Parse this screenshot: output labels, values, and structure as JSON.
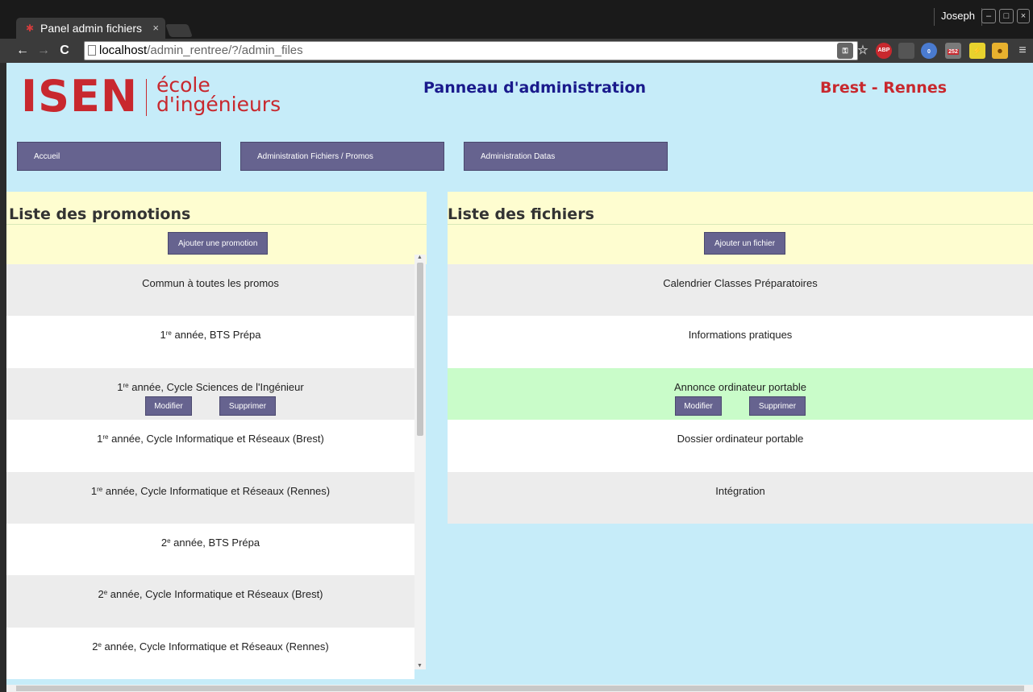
{
  "browser": {
    "tab_title": "Panel admin fichiers",
    "tab_close": "×",
    "user": "Joseph",
    "url_host": "localhost",
    "url_path": "/admin_rentree/?/admin_files",
    "back": "←",
    "forward": "→",
    "reload": "C",
    "ext_abp": "ABP",
    "ext_badge_0": "0",
    "ext_badge_252": "252"
  },
  "header": {
    "logo_main": "ISEN",
    "logo_sub_1": "école",
    "logo_sub_2": "d'ingénieurs",
    "title": "Panneau d'administration",
    "campus": "Brest - Rennes"
  },
  "nav": {
    "items": [
      {
        "label": "Accueil"
      },
      {
        "label": "Administration Fichiers / Promos"
      },
      {
        "label": "Administration Datas"
      }
    ]
  },
  "promotions": {
    "title": "Liste des promotions",
    "add_label": "Ajouter une promotion",
    "items": [
      {
        "prefix": "",
        "sup": "",
        "text": "Commun à toutes les promos"
      },
      {
        "prefix": "1",
        "sup": "re",
        "text": " année, BTS Prépa"
      },
      {
        "prefix": "1",
        "sup": "re",
        "text": " année, Cycle Sciences de l'Ingénieur"
      },
      {
        "prefix": "1",
        "sup": "re",
        "text": " année, Cycle Informatique et Réseaux (Brest)"
      },
      {
        "prefix": "1",
        "sup": "re",
        "text": " année, Cycle Informatique et Réseaux (Rennes)"
      },
      {
        "prefix": "2",
        "sup": "e",
        "text": " année, BTS Prépa"
      },
      {
        "prefix": "2",
        "sup": "e",
        "text": " année, Cycle Informatique et Réseaux (Brest)"
      },
      {
        "prefix": "2",
        "sup": "e",
        "text": " année, Cycle Informatique et Réseaux (Rennes)"
      }
    ],
    "modify_label": "Modifier",
    "delete_label": "Supprimer"
  },
  "files": {
    "title": "Liste des fichiers",
    "add_label": "Ajouter un fichier",
    "items": [
      {
        "text": "Calendrier Classes Préparatoires"
      },
      {
        "text": "Informations pratiques"
      },
      {
        "text": "Annonce ordinateur portable"
      },
      {
        "text": "Dossier ordinateur portable"
      },
      {
        "text": "Intégration"
      }
    ],
    "modify_label": "Modifier",
    "delete_label": "Supprimer"
  },
  "colors": {
    "page_bg": "#c6ecf9",
    "brand_red": "#c8282e",
    "title_blue": "#1a1a8c",
    "button_purple": "#66638f",
    "panel_header_yellow": "#fefdd0",
    "row_grey": "#ececec",
    "row_selected_green": "#c9fcc9"
  }
}
